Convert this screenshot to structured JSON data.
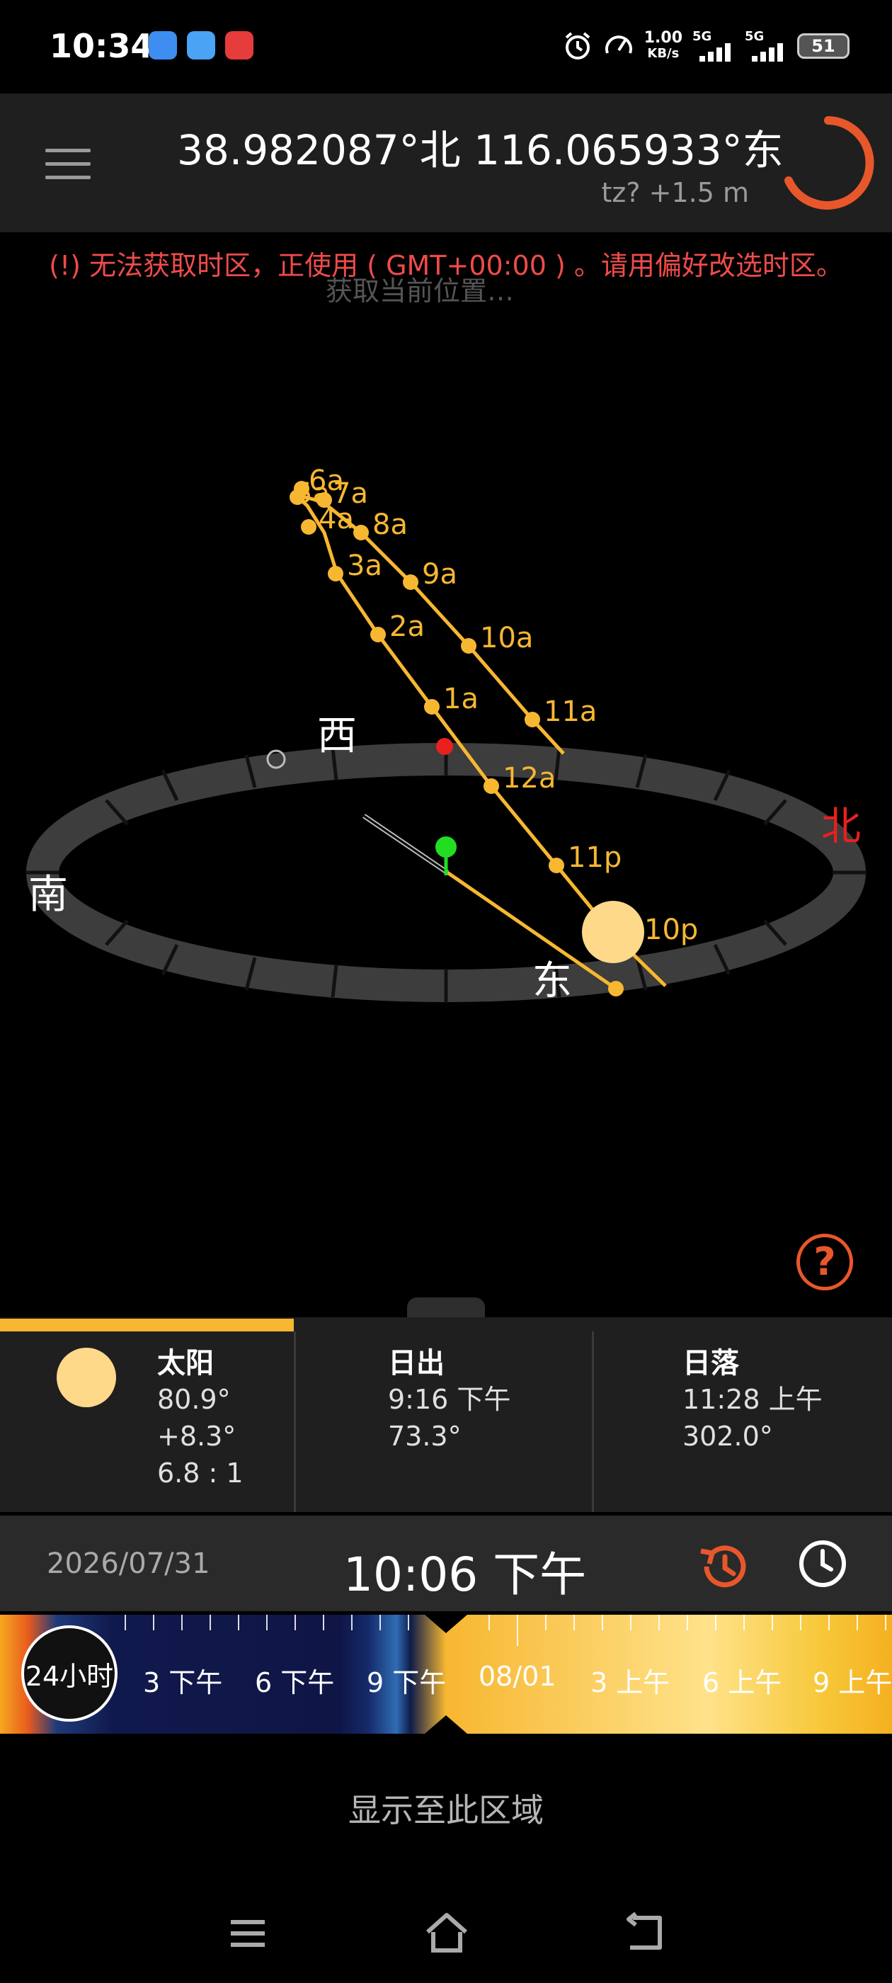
{
  "status_bar": {
    "time": "10:34",
    "net_speed_value": "1.00",
    "net_speed_unit": "KB/s",
    "sim1": "5G",
    "sim2": "5G",
    "battery": "51"
  },
  "header": {
    "coordinates": "38.982087°北  116.065933°东",
    "tz_altitude": "tz? +1.5 m"
  },
  "warning": "(!) 无法获取时区，正使用 ( GMT+00:00 ) 。请用偏好改选时区。",
  "ghost_text": "获取当前位置…",
  "compass": {
    "west": "西",
    "south": "南",
    "north": "北",
    "east": "东"
  },
  "sun_path_hours": [
    "6a",
    "5a",
    "7a",
    "4a",
    "8a",
    "3a",
    "9a",
    "2a",
    "10a",
    "1a",
    "11a",
    "12a",
    "11p",
    "10p"
  ],
  "info": {
    "sun": {
      "title": "太阳",
      "azimuth": "80.9°",
      "elevation": "+8.3°",
      "shadow_ratio": "6.8 : 1"
    },
    "sunrise": {
      "title": "日出",
      "time": "9:16 下午",
      "azimuth": "73.3°"
    },
    "sunset": {
      "title": "日落",
      "time": "11:28 上午",
      "azimuth": "302.0°"
    }
  },
  "datetime": {
    "date": "2026/07/31",
    "time": "10:06 下午"
  },
  "timeline": {
    "mode_button": "24小时",
    "labels": [
      "3 下午",
      "6 下午",
      "9 下午",
      "08/01",
      "3 上午",
      "6 上午",
      "9 上午"
    ]
  },
  "show_region": "显示至此区域",
  "colors": {
    "accent": "#e8572b",
    "sun": "#f7b731",
    "warning": "#ef4b4b"
  }
}
